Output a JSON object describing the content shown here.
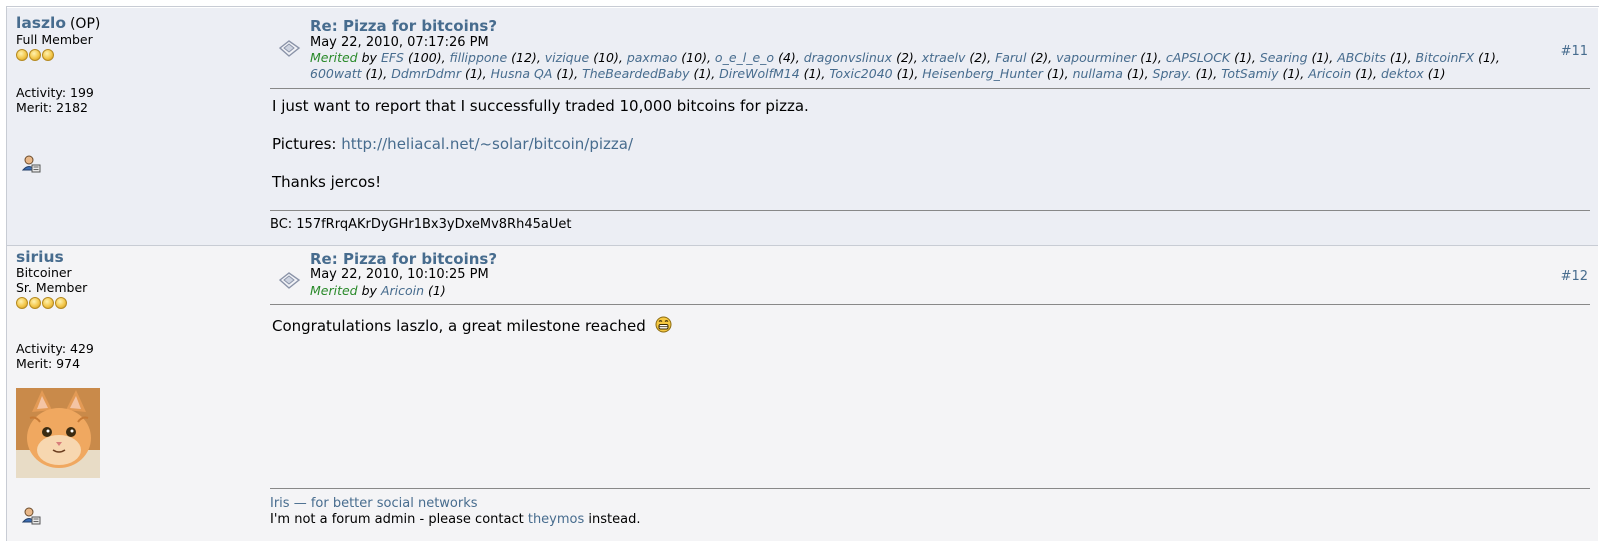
{
  "posts": [
    {
      "username": "laszlo",
      "op_tag": "(OP)",
      "rank": "Full Member",
      "stars": 3,
      "activity": "Activity: 199",
      "merit": "Merit: 2182",
      "subject": "Re: Pizza for bitcoins?",
      "date": "May 22, 2010, 07:17:26 PM",
      "merited_label": "Merited",
      "by": "by",
      "merited_by": [
        {
          "name": "EFS",
          "count": "(100)"
        },
        {
          "name": "fillippone",
          "count": "(12)"
        },
        {
          "name": "vizique",
          "count": "(10)"
        },
        {
          "name": "paxmao",
          "count": "(10)"
        },
        {
          "name": "o_e_l_e_o",
          "count": "(4)"
        },
        {
          "name": "dragonvslinux",
          "count": "(2)"
        },
        {
          "name": "xtraelv",
          "count": "(2)"
        },
        {
          "name": "Farul",
          "count": "(2)"
        },
        {
          "name": "vapourminer",
          "count": "(1)"
        },
        {
          "name": "cAPSLOCK",
          "count": "(1)"
        },
        {
          "name": "Searing",
          "count": "(1)"
        },
        {
          "name": "ABCbits",
          "count": "(1)"
        },
        {
          "name": "BitcoinFX",
          "count": "(1)"
        },
        {
          "name": "600watt",
          "count": "(1)"
        },
        {
          "name": "DdmrDdmr",
          "count": "(1)"
        },
        {
          "name": "Husna QA",
          "count": "(1)"
        },
        {
          "name": "TheBeardedBaby",
          "count": "(1)"
        },
        {
          "name": "DireWolfM14",
          "count": "(1)"
        },
        {
          "name": "Toxic2040",
          "count": "(1)"
        },
        {
          "name": "Heisenberg_Hunter",
          "count": "(1)"
        },
        {
          "name": "nullama",
          "count": "(1)"
        },
        {
          "name": "Spray.",
          "count": "(1)"
        },
        {
          "name": "TotSamiy",
          "count": "(1)"
        },
        {
          "name": "Aricoin",
          "count": "(1)"
        },
        {
          "name": "dektox",
          "count": "(1)"
        }
      ],
      "post_number": "#11",
      "body_line1": "I just want to report that I successfully traded 10,000 bitcoins for pizza.",
      "pictures_label": "Pictures:",
      "pictures_link": "http://heliacal.net/~solar/bitcoin/pizza/",
      "body_line3": "Thanks jercos!",
      "signature": "BC: 157fRrqAKrDyGHr1Bx3yDxeMv8Rh45aUet"
    },
    {
      "username": "sirius",
      "rank": "Bitcoiner",
      "rank2": "Sr. Member",
      "stars": 4,
      "activity": "Activity: 429",
      "merit": "Merit: 974",
      "subject": "Re: Pizza for bitcoins?",
      "date": "May 22, 2010, 10:10:25 PM",
      "merited_label": "Merited",
      "by": "by",
      "merited_by": [
        {
          "name": "Aricoin",
          "count": "(1)"
        }
      ],
      "post_number": "#12",
      "body_line1": "Congratulations laszlo, a great milestone reached",
      "sig_link": "Iris — for better social networks",
      "sig_text_prefix": "I'm not a forum admin - please contact",
      "sig_link2": "theymos",
      "sig_text_suffix": "instead."
    }
  ],
  "colors": {
    "link": "#476c8e",
    "merited": "#2a8a2a",
    "post1_bg": "#eceef4",
    "post2_bg": "#f4f4f6"
  },
  "icons": [
    "topic-icon",
    "profile-icon",
    "grin-emoji-icon",
    "star-icon",
    "kitten-avatar"
  ]
}
